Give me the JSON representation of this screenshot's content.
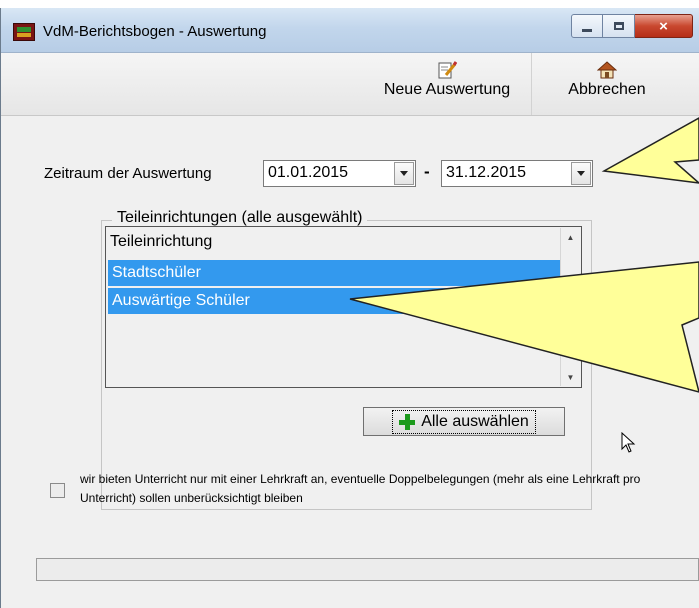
{
  "window": {
    "title": "VdM-Berichtsbogen - Auswertung",
    "close_glyph": "×"
  },
  "toolbar": {
    "new_label": "Neue Auswertung",
    "cancel_label": "Abbrechen"
  },
  "period": {
    "label": "Zeitraum der Auswertung",
    "from": "01.01.2015",
    "separator": "-",
    "to": "31.12.2015"
  },
  "facilities": {
    "legend": "Teileinrichtungen (alle ausgewählt)",
    "column_header": "Teileinrichtung",
    "items": [
      {
        "label": "Stadtschüler",
        "selected": true
      },
      {
        "label": "Auswärtige Schüler",
        "selected": true
      }
    ],
    "select_all_label": "Alle auswählen"
  },
  "options": {
    "single_teacher_checked": false,
    "single_teacher_text": "wir bieten Unterricht nur mit einer Lehrkraft an, eventuelle Doppelbelegungen (mehr als eine Lehrkraft pro Unterricht) sollen unberücksichtigt bleiben"
  },
  "progress": {
    "value": 0
  },
  "colors": {
    "selection": "#3399ee",
    "callout": "#ffff99",
    "plus_icon": "#1c9a1c",
    "close_button": "#c9482f"
  }
}
